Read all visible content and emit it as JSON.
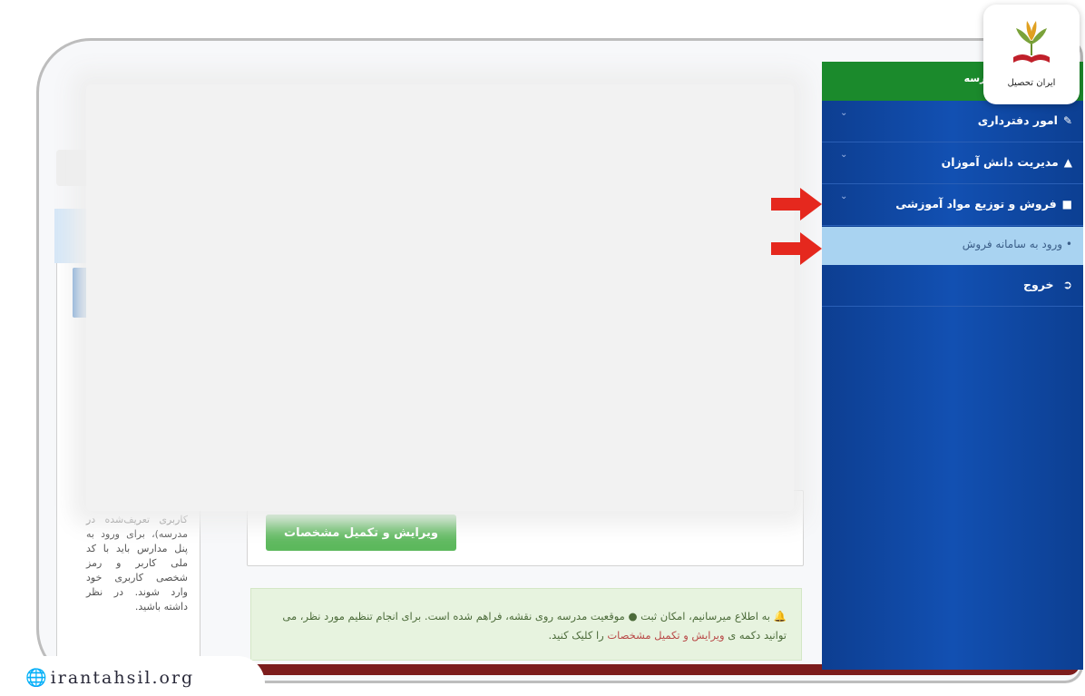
{
  "sidebar": {
    "header": "...رسه",
    "items": [
      {
        "label": "امور دفترداری",
        "icon": "edit-icon"
      },
      {
        "label": "مدیریت دانش آموزان",
        "icon": "graduation-cap-icon"
      },
      {
        "label": "فروش و توزیع مواد آموزشی",
        "icon": "cart-icon"
      }
    ],
    "submenu_label": "ورود به سامانه فروش",
    "logout_label": "خروج"
  },
  "main": {
    "edit_button": "ویرایش و تکمیل مشخصات",
    "alert_part1": "به اطلاع میرسانیم، امکان ثبت",
    "alert_part2": "موقعیت مدرسه روی نقشه، فراهم شده است. برای انجام تنظیم مورد نظر، می توانید دکمه ی",
    "alert_link": "ویرایش و تکمیل مشخصات",
    "alert_part3": "را کلیک کنید.",
    "left_text": "کاربری تعریف‌شده در مدرسه)، برای ورود به پنل مدارس باید با کد ملی کاربر و رمز شخصی کاربری خود وارد شوند. در نظر داشته باشید."
  },
  "branding": {
    "logo_text": "ایران تحصیل",
    "watermark": "irantahsil.org"
  },
  "colors": {
    "sidebar": "#1250b2",
    "sidebar_header": "#1b8a2c",
    "submenu": "#a9d3f1",
    "button": "#5cb85c",
    "arrow": "#e5281e"
  }
}
